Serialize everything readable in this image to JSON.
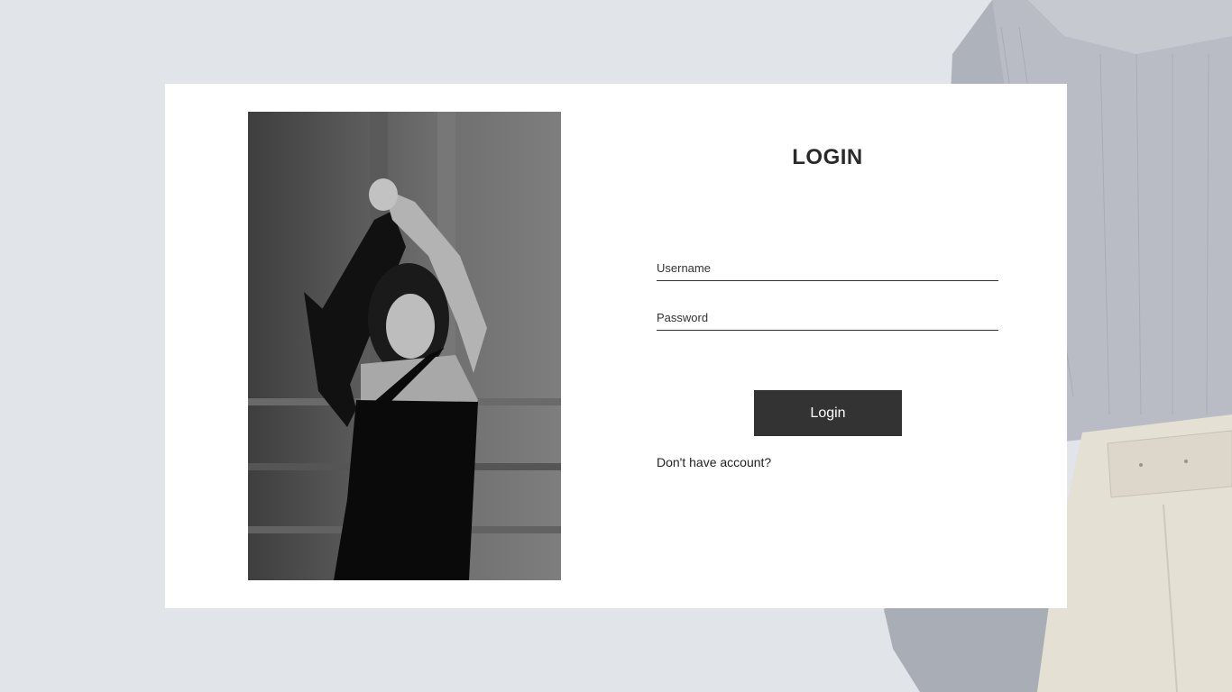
{
  "login": {
    "title": "LOGIN",
    "username_placeholder": "Username",
    "password_placeholder": "Password",
    "button_label": "Login",
    "signup_link": "Don't have account?"
  },
  "colors": {
    "background": "#e1e5e9",
    "card": "#ffffff",
    "button": "#333333",
    "button_text": "#ffffff",
    "text": "#2a2a2a"
  }
}
